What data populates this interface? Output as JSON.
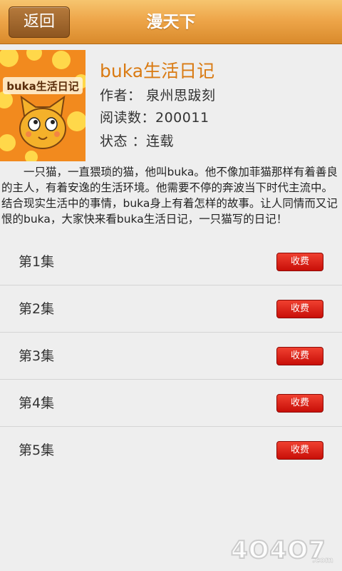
{
  "header": {
    "back_label": "返回",
    "title": "漫天下"
  },
  "comic": {
    "cover_text": "buka生活日记",
    "title": "buka生活日记",
    "author_line": "作者： 泉州思跋刻",
    "reads_line": "阅读数：200011",
    "status_line": "状态 ：连载",
    "description": "一只猫，一直猥琐的猫，他叫buka。他不像加菲猫那样有着善良的主人，有着安逸的生活环境。他需要不停的奔波当下时代主流中。结合现实生活中的事情，buka身上有着怎样的故事。让人同情而又记恨的buka，大家快来看buka生活日记，一只猫写的日记！"
  },
  "episodes": [
    {
      "label": "第1集",
      "fee_label": "收费"
    },
    {
      "label": "第2集",
      "fee_label": "收费"
    },
    {
      "label": "第3集",
      "fee_label": "收费"
    },
    {
      "label": "第4集",
      "fee_label": "收费"
    },
    {
      "label": "第5集",
      "fee_label": "收费"
    }
  ],
  "watermark": "4O4O7.com",
  "colors": {
    "header": "#eea64a",
    "back_button": "#9c6428",
    "accent_title": "#d97a12",
    "fee_button": "#e02a1e",
    "background": "#eeeeee"
  }
}
